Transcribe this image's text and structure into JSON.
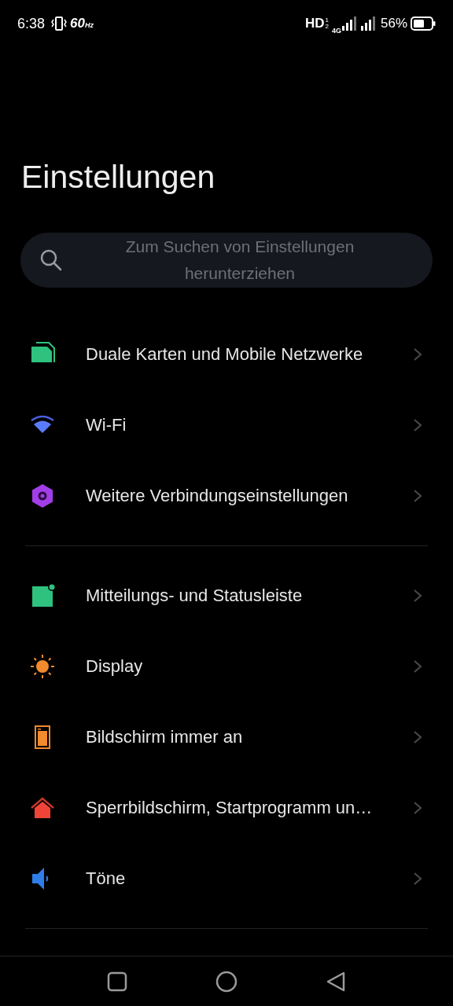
{
  "status_bar": {
    "time": "6:38",
    "refresh": "60$_{Hz}$",
    "network": "HD",
    "sim_slots": [
      "1",
      "2"
    ],
    "mobile_data": "4G",
    "battery": "56%"
  },
  "title": "Einstellungen",
  "search": {
    "placeholder": "Zum Suchen von Einstellungen herunterziehen"
  },
  "groups": [
    {
      "items": [
        {
          "kind": "sim",
          "label": "Duale Karten und Mobile Netzwerke"
        },
        {
          "kind": "wifi",
          "label": "Wi-Fi"
        },
        {
          "kind": "hexagon",
          "label": "Weitere Verbindungseinstellungen"
        }
      ]
    },
    {
      "items": [
        {
          "kind": "notification",
          "label": "Mitteilungs- und Statusleiste"
        },
        {
          "kind": "sun",
          "label": "Display"
        },
        {
          "kind": "phone",
          "label": "Bildschirm immer an"
        },
        {
          "kind": "home",
          "label": "Sperrbildschirm, Startprogramm un…"
        },
        {
          "kind": "speaker",
          "label": "Töne"
        }
      ]
    }
  ]
}
